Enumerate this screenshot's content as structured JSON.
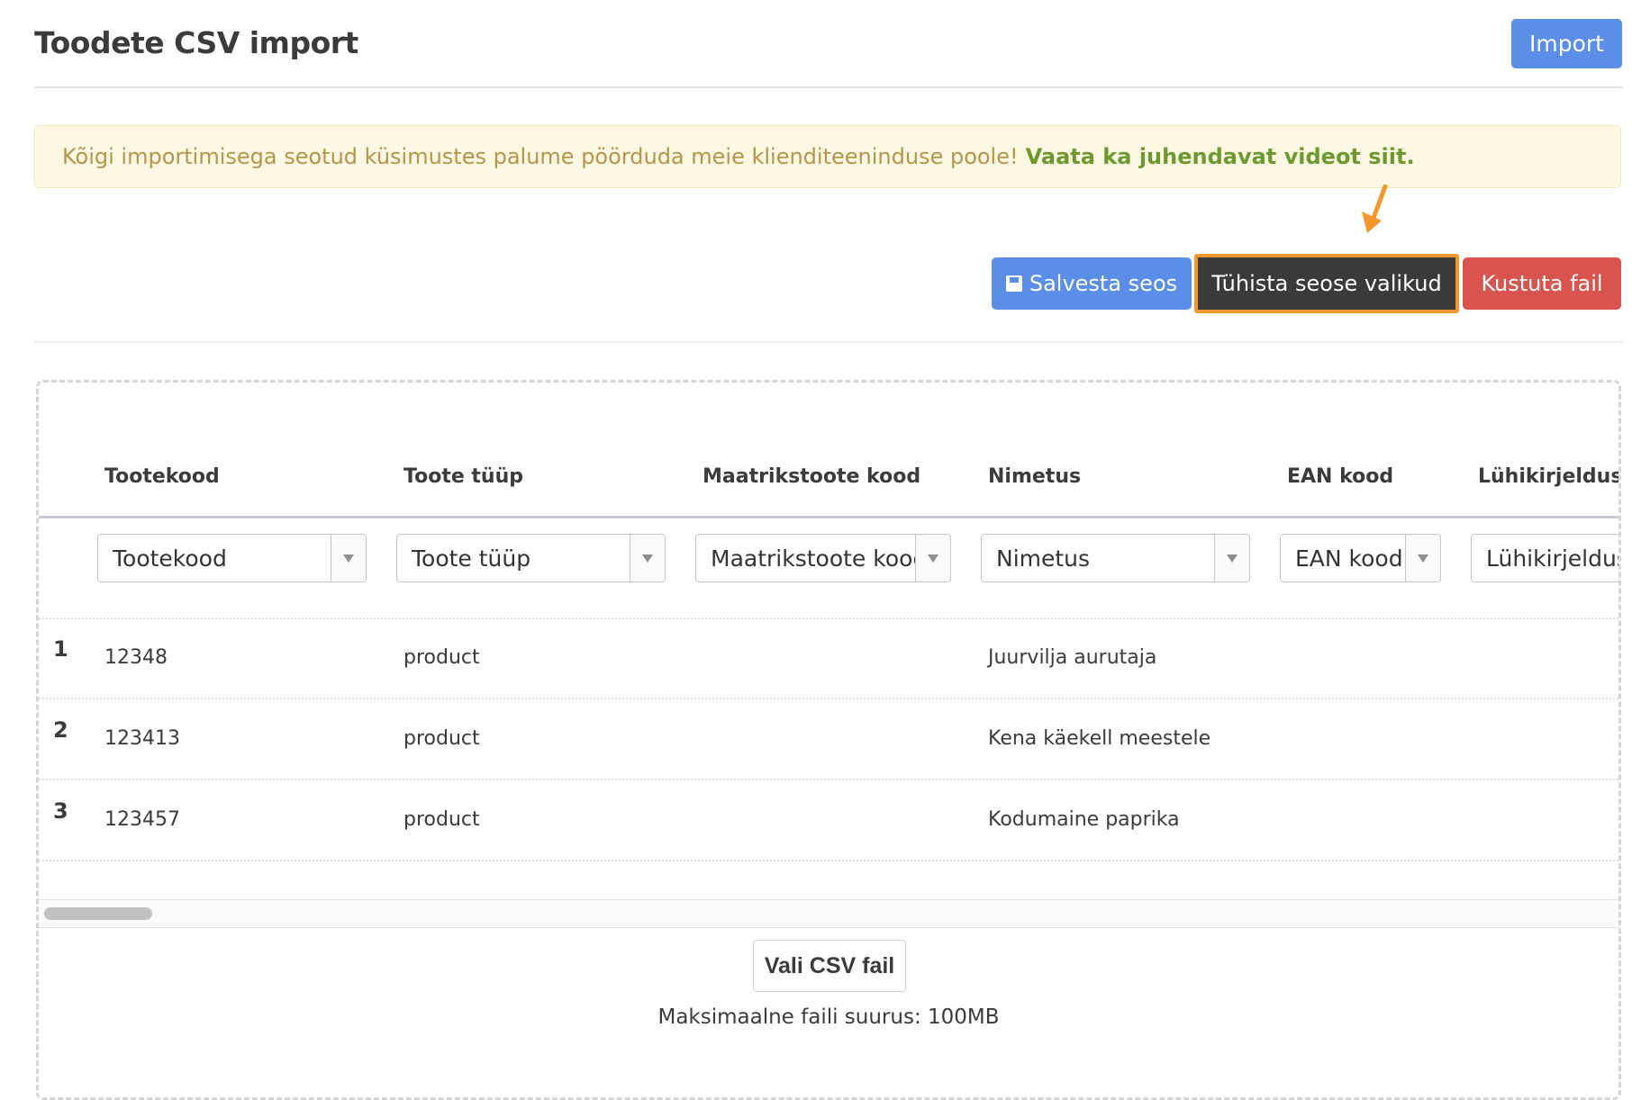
{
  "header": {
    "title": "Toodete CSV import",
    "import_label": "Import"
  },
  "notice": {
    "text": "Kõigi importimisega seotud küsimustes palume pöörduda meie klienditeeninduse poole!",
    "link_text": "Vaata ka juhendavat videot siit."
  },
  "actions": {
    "save_label": "Salvesta seos",
    "reset_label": "Tühista seose valikud",
    "delete_label": "Kustuta fail"
  },
  "colors": {
    "primary": "#5b8ee6",
    "dark": "#3a3a3a",
    "danger": "#d9534f",
    "highlight": "#f2962e",
    "notice_bg": "#fcf8e3",
    "notice_text": "#b6954a",
    "notice_link": "#6c9a2f"
  },
  "table": {
    "columns": [
      "Tootekood",
      "Toote tüüp",
      "Maatrikstoote kood",
      "Nimetus",
      "EAN kood",
      "Lühikirjeldus"
    ],
    "mappings": [
      "Tootekood",
      "Toote tüüp",
      "Maatrikstoote kood",
      "Nimetus",
      "EAN kood",
      "Lühikirjeldus"
    ],
    "rows": [
      {
        "num": "1",
        "code": "12348",
        "type": "product",
        "name": "Juurvilja aurutaja"
      },
      {
        "num": "2",
        "code": "123413",
        "type": "product",
        "name": "Kena käekell meestele"
      },
      {
        "num": "3",
        "code": "123457",
        "type": "product",
        "name": "Kodumaine paprika"
      }
    ]
  },
  "upload": {
    "choose_label": "Vali CSV fail",
    "max_size_text": "Maksimaalne faili suurus: 100MB"
  }
}
